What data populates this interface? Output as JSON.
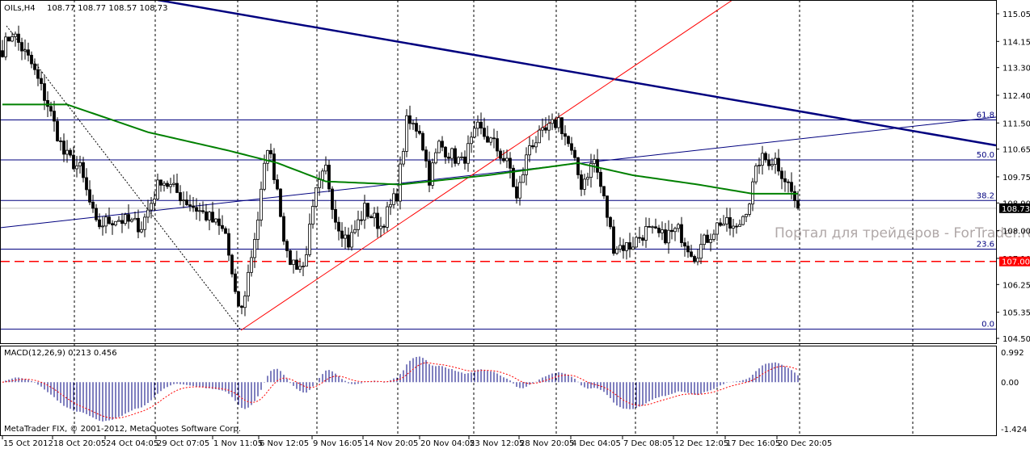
{
  "header": {
    "symbol": "OILs,H4",
    "ohlc": "108.77 108.77 108.57 108.73"
  },
  "watermark": "Портал для трейдеров - ForTrader.ru",
  "copyright": "MetaTrader FIX, © 2001-2012, MetaQuotes Software Corp.",
  "chart_data": {
    "type": "candlestick",
    "symbol": "OILs",
    "timeframe": "H4",
    "price_axis": {
      "min": 104.5,
      "max": 115.05,
      "ticks": [
        "115.05",
        "114.15",
        "113.30",
        "112.40",
        "111.50",
        "110.65",
        "109.75",
        "108.90",
        "108.00",
        "107.10",
        "106.25",
        "105.35",
        "104.50"
      ]
    },
    "time_labels": [
      "15 Oct 2012",
      "18 Oct 20:05",
      "24 Oct 04:05",
      "29 Oct 07:05",
      "1 Nov 11:05",
      "6 Nov 12:05",
      "9 Nov 16:05",
      "14 Nov 20:05",
      "20 Nov 04:05",
      "23 Nov 12:05",
      "28 Nov 20:05",
      "4 Dec 04:05",
      "7 Dec 08:05",
      "12 Dec 12:05",
      "17 Dec 16:05",
      "20 Dec 20:05"
    ],
    "bar_count": 247,
    "close_path": [
      [
        0,
        113.9
      ],
      [
        3,
        114.45
      ],
      [
        9,
        113.4
      ],
      [
        14,
        112.1
      ],
      [
        19,
        110.5
      ],
      [
        24,
        110.0
      ],
      [
        29,
        108.15
      ],
      [
        35,
        108.4
      ],
      [
        43,
        108.15
      ],
      [
        49,
        109.7
      ],
      [
        57,
        108.95
      ],
      [
        64,
        108.4
      ],
      [
        69,
        107.9
      ],
      [
        72,
        105.8
      ],
      [
        74,
        105.4
      ],
      [
        79,
        108.4
      ],
      [
        82,
        110.8
      ],
      [
        85,
        109.4
      ],
      [
        88,
        107.1
      ],
      [
        93,
        106.8
      ],
      [
        97,
        109.2
      ],
      [
        100,
        110.0
      ],
      [
        103,
        108.4
      ],
      [
        107,
        107.6
      ],
      [
        112,
        108.7
      ],
      [
        117,
        108.15
      ],
      [
        122,
        109.2
      ],
      [
        125,
        111.5
      ],
      [
        129,
        111.3
      ],
      [
        132,
        109.7
      ],
      [
        135,
        110.8
      ],
      [
        142,
        110.2
      ],
      [
        147,
        111.3
      ],
      [
        152,
        110.8
      ],
      [
        157,
        110.0
      ],
      [
        159,
        109.0
      ],
      [
        163,
        110.8
      ],
      [
        167,
        111.1
      ],
      [
        172,
        111.6
      ],
      [
        175,
        110.8
      ],
      [
        179,
        109.5
      ],
      [
        183,
        110.3
      ],
      [
        186,
        109.0
      ],
      [
        189,
        107.5
      ],
      [
        194,
        107.5
      ],
      [
        199,
        108.0
      ],
      [
        204,
        107.8
      ],
      [
        209,
        108.0
      ],
      [
        214,
        107.2
      ],
      [
        216,
        107.5
      ],
      [
        222,
        108.3
      ],
      [
        227,
        108.0
      ],
      [
        231,
        109.0
      ],
      [
        234,
        110.3
      ],
      [
        239,
        110.3
      ],
      [
        243,
        109.5
      ],
      [
        246,
        108.73
      ]
    ],
    "current_price": 108.73,
    "indicators": {
      "moving_average": {
        "color": "#008000",
        "path": [
          [
            0,
            112.1
          ],
          [
            20,
            112.1
          ],
          [
            45,
            111.2
          ],
          [
            70,
            110.6
          ],
          [
            85,
            110.2
          ],
          [
            100,
            109.6
          ],
          [
            123,
            109.5
          ],
          [
            150,
            109.8
          ],
          [
            178,
            110.2
          ],
          [
            195,
            109.8
          ],
          [
            215,
            109.5
          ],
          [
            232,
            109.2
          ],
          [
            246,
            109.2
          ]
        ]
      },
      "macd": {
        "label": "MACD(12,26,9) 0.213 0.456",
        "params": [
          12,
          26,
          9
        ],
        "main": 0.213,
        "signal": 0.456,
        "axis": [
          "0.992",
          "0.00",
          "-1.424"
        ],
        "range": [
          -1.424,
          0.992
        ]
      }
    },
    "fibonacci": {
      "levels": [
        {
          "label": "61.8",
          "price": 111.6
        },
        {
          "label": "50.0",
          "price": 110.3
        },
        {
          "label": "38.2",
          "price": 108.98
        },
        {
          "label": "23.6",
          "price": 107.4
        },
        {
          "label": "0.0",
          "price": 104.8
        }
      ]
    },
    "horizontal_line": {
      "price": 107.0,
      "label": "107.00",
      "color": "#ff0000"
    },
    "price_label": "108.73"
  }
}
